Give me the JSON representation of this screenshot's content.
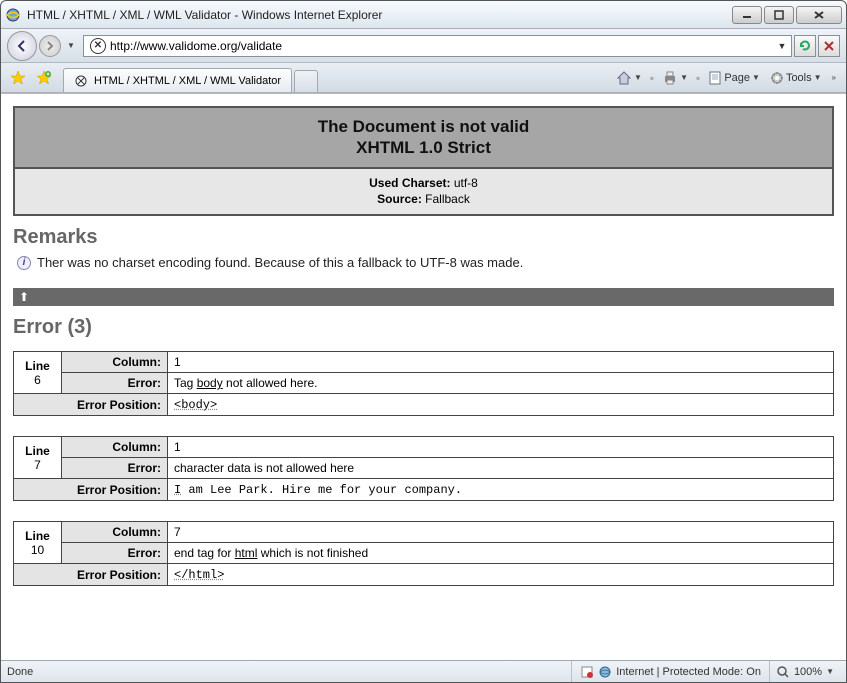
{
  "window": {
    "title": "HTML / XHTML / XML / WML Validator - Windows Internet Explorer"
  },
  "address": {
    "url": "http://www.validome.org/validate"
  },
  "tab": {
    "label": "HTML / XHTML / XML / WML Validator"
  },
  "toolbar": {
    "page_label": "Page",
    "tools_label": "Tools"
  },
  "validator": {
    "title_line1": "The Document is not valid",
    "title_line2": "XHTML 1.0 Strict",
    "used_charset_label": "Used Charset:",
    "used_charset_value": "utf-8",
    "source_label": "Source:",
    "source_value": "Fallback"
  },
  "remarks": {
    "heading": "Remarks",
    "text": "Ther was no charset encoding found. Because of this a fallback to UTF-8 was made."
  },
  "errors": {
    "heading": "Error (3)",
    "line_label": "Line",
    "column_label": "Column:",
    "error_label": "Error:",
    "position_label": "Error Position:",
    "items": [
      {
        "line": "6",
        "column": "1",
        "err_pre": "Tag ",
        "err_hl": "body",
        "err_post": " not allowed here.",
        "pos_pre": "",
        "pos_hl": "<body>",
        "pos_post": ""
      },
      {
        "line": "7",
        "column": "1",
        "err_pre": "character data is not allowed here",
        "err_hl": "",
        "err_post": "",
        "pos_pre": "",
        "pos_hl": "I",
        "pos_post": " am Lee Park. Hire me for your company."
      },
      {
        "line": "10",
        "column": "7",
        "err_pre": "end tag for ",
        "err_hl": "html",
        "err_post": " which is not finished",
        "pos_pre": "",
        "pos_hl": "</html>",
        "pos_post": ""
      }
    ]
  },
  "status": {
    "done": "Done",
    "zone": "Internet | Protected Mode: On",
    "zoom": "100%"
  }
}
